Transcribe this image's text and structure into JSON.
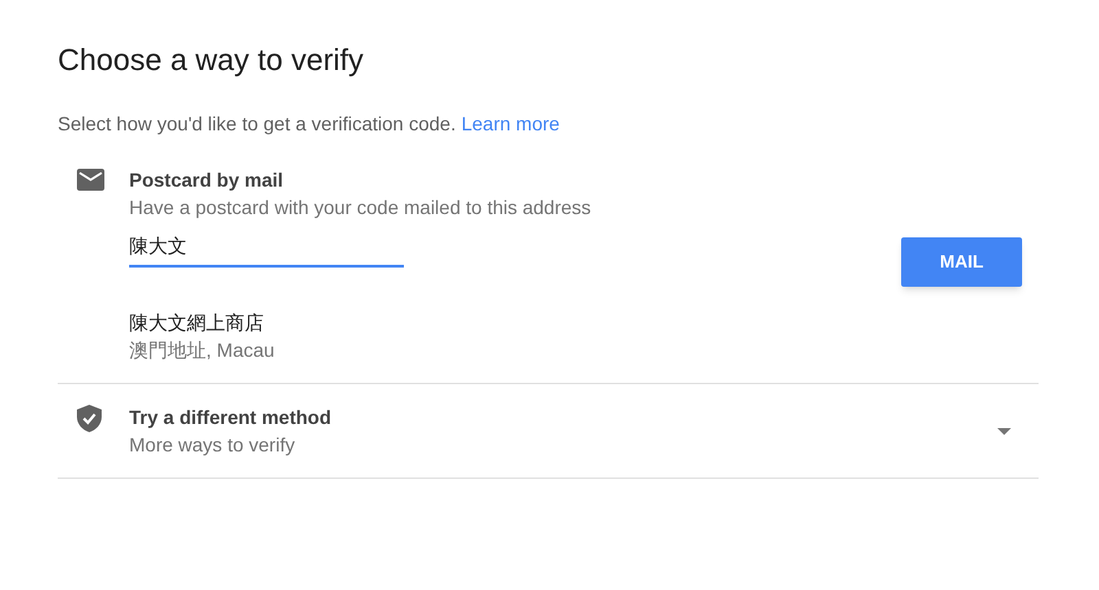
{
  "title": "Choose a way to verify",
  "subtitle": {
    "text": "Select how you'd like to get a verification code.",
    "link": "Learn more"
  },
  "postcard": {
    "title": "Postcard by mail",
    "description": "Have a postcard with your code mailed to this address",
    "name_field": {
      "value": "陳大文",
      "focused": true
    },
    "button": "MAIL",
    "address_line_1": "陳大文網上商店",
    "address_line_2": "澳門地址, Macau"
  },
  "other_method": {
    "title": "Try a different method",
    "description": "More ways to verify",
    "expanded": false
  }
}
